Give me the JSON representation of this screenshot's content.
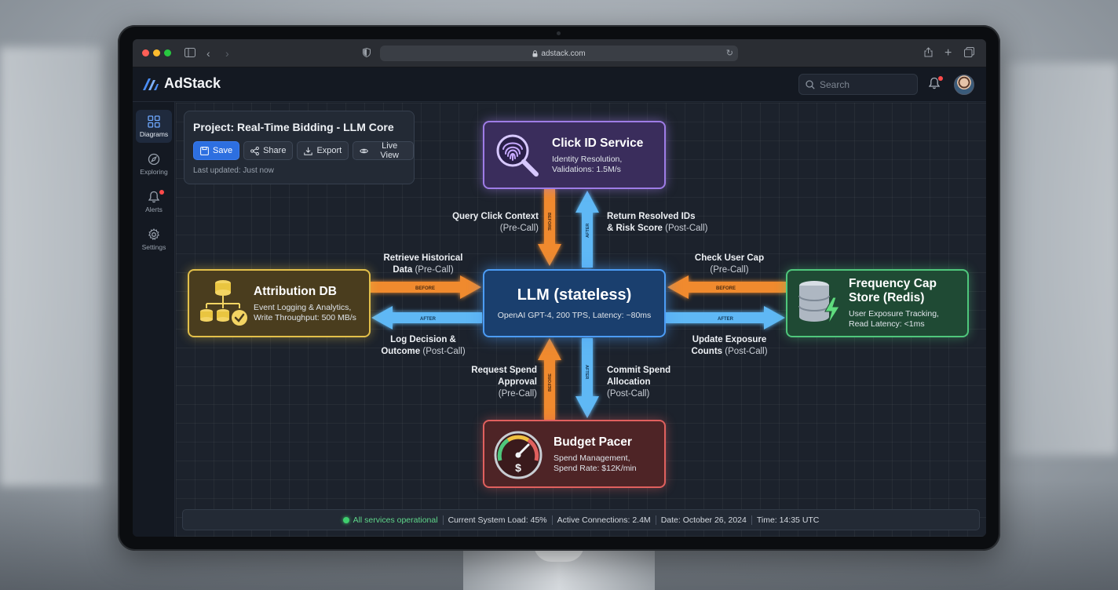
{
  "browser": {
    "url": "adstack.com"
  },
  "app": {
    "name": "AdStack",
    "search_placeholder": "Search"
  },
  "sidebar": {
    "items": [
      {
        "label": "Diagrams"
      },
      {
        "label": "Exploring"
      },
      {
        "label": "Alerts"
      },
      {
        "label": "Settings"
      }
    ]
  },
  "project": {
    "title": "Project: Real-Time Bidding - LLM Core",
    "save_label": "Save",
    "share_label": "Share",
    "export_label": "Export",
    "live_view_label": "Live View",
    "last_updated": "Last updated: Just now"
  },
  "nodes": {
    "click": {
      "title": "Click ID Service",
      "desc1": "Identity Resolution,",
      "desc2": "Validations: 1.5M/s"
    },
    "llm": {
      "title": "LLM (stateless)",
      "desc": "OpenAI GPT-4, 200 TPS, Latency: ~80ms"
    },
    "attribution": {
      "title": "Attribution DB",
      "desc1": "Event Logging & Analytics,",
      "desc2": "Write Throughput: 500 MB/s"
    },
    "frequency": {
      "title1": "Frequency Cap",
      "title2": "Store (Redis)",
      "desc1": "User Exposure Tracking,",
      "desc2": "Read Latency: <1ms"
    },
    "budget": {
      "title": "Budget Pacer",
      "desc1": "Spend Management,",
      "desc2": "Spend Rate: $12K/min"
    }
  },
  "edges": {
    "query_click": {
      "line1": "Query Click Context",
      "line2": "(Pre-Call)"
    },
    "return_ids": {
      "line1": "Return Resolved IDs",
      "line2a": "& Risk Score",
      "line2b": "(Post-Call)"
    },
    "retrieve_hist": {
      "line1": "Retrieve Historical",
      "line2a": "Data",
      "line2b": "(Pre-Call)"
    },
    "log_decision": {
      "line1": "Log Decision &",
      "line2a": "Outcome",
      "line2b": "(Post-Call)"
    },
    "check_cap": {
      "line1": "Check User Cap",
      "line2": "(Pre-Call)"
    },
    "update_exposure": {
      "line1": "Update Exposure",
      "line2a": "Counts",
      "line2b": "(Post-Call)"
    },
    "request_spend": {
      "line1": "Request Spend",
      "line2": "Approval",
      "line3": "(Pre-Call)"
    },
    "commit_spend": {
      "line1": "Commit Spend",
      "line2": "Allocation",
      "line3": "(Post-Call)"
    },
    "arrow_before": "BEFORE",
    "arrow_after": "AFTER"
  },
  "status": {
    "operational": "All services operational",
    "load": "Current System Load: 45%",
    "connections": "Active Connections: 2.4M",
    "date": "Date: October 26, 2024",
    "time": "Time: 14:35 UTC"
  },
  "colors": {
    "before_arrow": "#f08a2e",
    "after_arrow": "#5fb8f5",
    "llm_border": "#4c9cf5",
    "click_border": "#9e7ce6",
    "attribution_border": "#e3c04a",
    "frequency_border": "#4fc77c",
    "budget_border": "#e0605e"
  },
  "icons": {
    "click": "fingerprint-magnifier-icon",
    "attribution": "database-tree-check-icon",
    "frequency": "database-bolt-icon",
    "budget": "speedometer-dollar-icon"
  }
}
